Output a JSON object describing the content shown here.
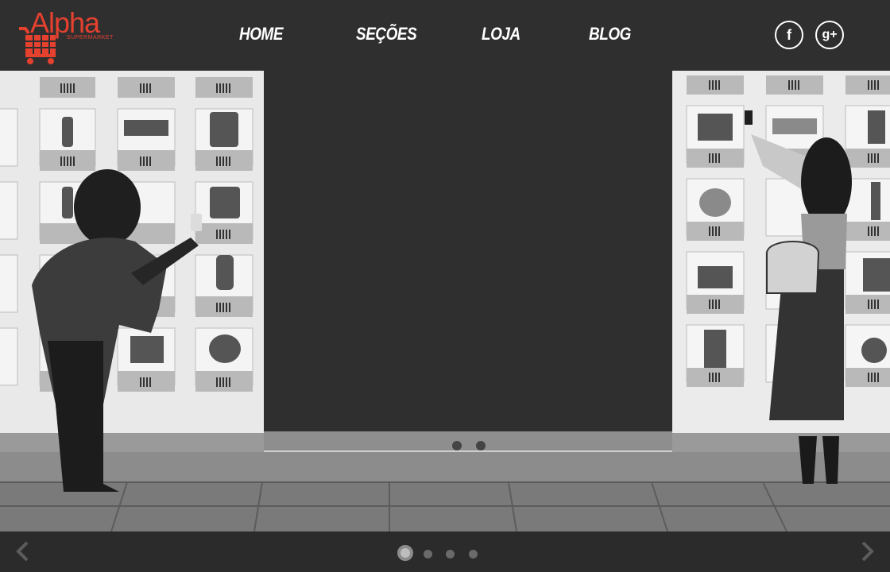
{
  "brand": {
    "name": "Alpha",
    "tagline": "SUPERMARKET",
    "accent_color": "#e5412f"
  },
  "nav": {
    "items": [
      {
        "label": "HOME"
      },
      {
        "label": "SEÇÕES"
      },
      {
        "label": "LOJA"
      },
      {
        "label": "BLOG"
      }
    ]
  },
  "social": {
    "facebook_glyph": "f",
    "googleplus_glyph": "g+",
    "icons": [
      "facebook-icon",
      "google-plus-icon"
    ]
  },
  "slider": {
    "slide_count": 4,
    "active_index": 0,
    "prev_icon": "chevron-left-icon",
    "next_icon": "chevron-right-icon",
    "image_description_icon": "hero-photo"
  },
  "colors": {
    "header_bg": "#2f2f30",
    "controls_bg": "#2b2b2c",
    "nav_text": "#ffffff"
  }
}
